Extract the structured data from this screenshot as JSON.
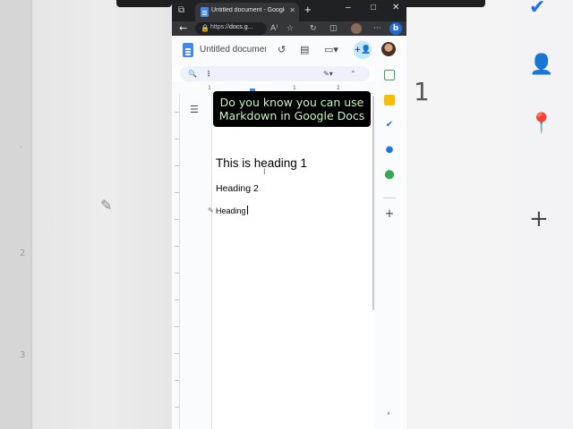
{
  "browser": {
    "tab_title": "Untitled document - Google Docs",
    "new_tab_label": "+",
    "controls": {
      "minimize": "–",
      "maximize": "□",
      "close": "✕"
    },
    "address": {
      "scheme": "https://",
      "host": "docs.g..."
    }
  },
  "docs": {
    "doc_title": "Untitled document",
    "share_label": "+"
  },
  "ruler": {
    "numbers": [
      "1",
      "1",
      "2"
    ]
  },
  "document": {
    "heading1": "This is heading 1",
    "heading2": "Heading 2",
    "heading3": "Heading"
  },
  "caption": {
    "line1": "Do you know you can use",
    "line2": "Markdown in Google Docs"
  },
  "background": {
    "right_number": "1"
  },
  "colors": {
    "docs_blue": "#4285f4",
    "caption_text": "#c8f5c0",
    "share_bg": "#c2e7ff"
  }
}
